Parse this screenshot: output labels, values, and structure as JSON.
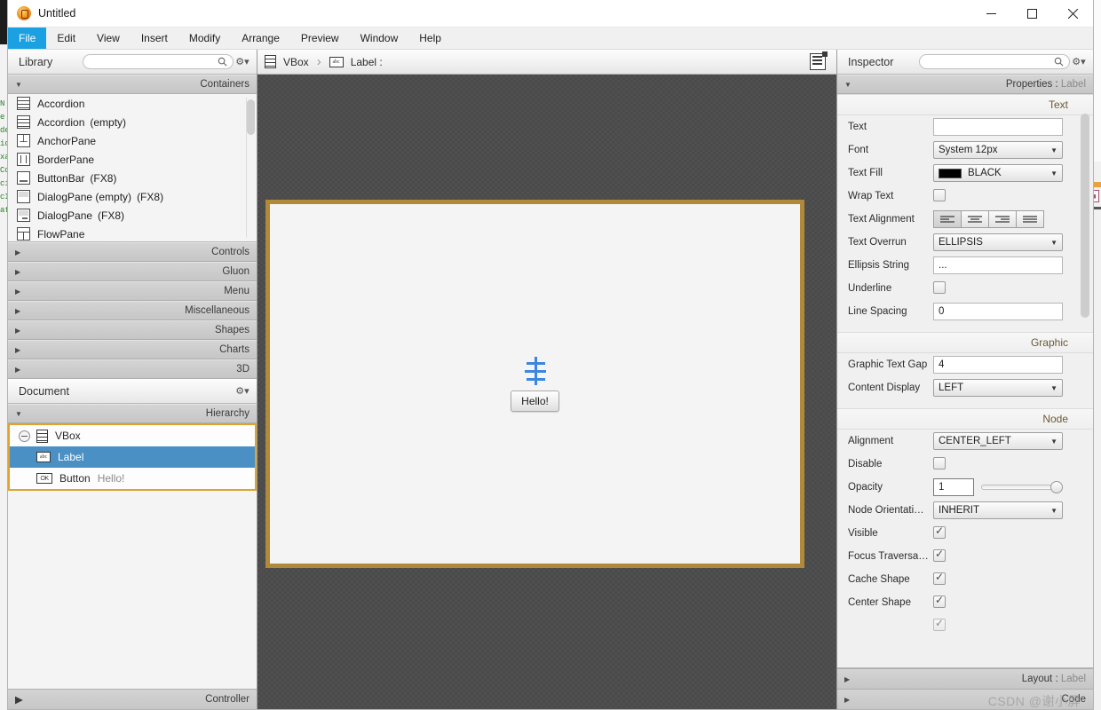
{
  "window": {
    "title": "Untitled",
    "app_icon": "scenebuilder-icon",
    "controls": {
      "minimize": "minimize-icon",
      "maximize": "maximize-icon",
      "close": "close-icon"
    }
  },
  "menubar": {
    "items": [
      {
        "label": "File",
        "mnemonic": "F",
        "active": true
      },
      {
        "label": "Edit",
        "mnemonic": "E",
        "active": false
      },
      {
        "label": "View",
        "mnemonic": "V",
        "active": false
      },
      {
        "label": "Insert",
        "mnemonic": "I",
        "active": false
      },
      {
        "label": "Modify",
        "mnemonic": "o",
        "active": false
      },
      {
        "label": "Arrange",
        "mnemonic": "A",
        "active": false
      },
      {
        "label": "Preview",
        "mnemonic": "P",
        "active": false
      },
      {
        "label": "Window",
        "mnemonic": "W",
        "active": false
      },
      {
        "label": "Help",
        "mnemonic": "",
        "active": false
      }
    ]
  },
  "library": {
    "title": "Library",
    "search_placeholder": "",
    "search_value": "",
    "search_icon": "search-icon",
    "gear_icon": "gear-icon",
    "section": {
      "label": "Containers",
      "expanded": true
    },
    "items": [
      {
        "name": "Accordion",
        "suffix": "",
        "icon": "accordion-icon"
      },
      {
        "name": "Accordion",
        "suffix": "(empty)",
        "icon": "accordion-empty-icon"
      },
      {
        "name": "AnchorPane",
        "suffix": "",
        "icon": "anchorpane-icon"
      },
      {
        "name": "BorderPane",
        "suffix": "",
        "icon": "borderpane-icon"
      },
      {
        "name": "ButtonBar",
        "suffix": "(FX8)",
        "icon": "buttonbar-icon"
      },
      {
        "name": "DialogPane (empty)",
        "suffix": "(FX8)",
        "icon": "dialogpane-empty-icon"
      },
      {
        "name": "DialogPane",
        "suffix": "(FX8)",
        "icon": "dialogpane-icon"
      },
      {
        "name": "FlowPane",
        "suffix": "",
        "icon": "flowpane-icon"
      }
    ],
    "collapsed_sections": [
      "Controls",
      "Gluon",
      "Menu",
      "Miscellaneous",
      "Shapes",
      "Charts",
      "3D"
    ]
  },
  "document": {
    "title": "Document",
    "gear_icon": "gear-icon",
    "hierarchy_label": "Hierarchy",
    "controller_label": "Controller",
    "tree": [
      {
        "label": "VBox",
        "value": "",
        "icon": "vbox-icon",
        "selected": false,
        "indent": 0,
        "expander": "collapse-icon"
      },
      {
        "label": "Label",
        "value": "",
        "icon": "label-icon",
        "selected": true,
        "indent": 1,
        "expander": ""
      },
      {
        "label": "Button",
        "value": "Hello!",
        "icon": "button-icon",
        "selected": false,
        "indent": 1,
        "expander": ""
      }
    ]
  },
  "breadcrumb": {
    "items": [
      {
        "label": "VBox",
        "icon": "vbox-icon"
      },
      {
        "label": "Label :",
        "icon": "label-icon"
      }
    ],
    "separator": "›",
    "doc_icon": "document-icon"
  },
  "canvas": {
    "selected_node": "VBox",
    "label_placeholder_icon": "empty-label-placeholder",
    "button_text": "Hello!",
    "selection_color": "#b08a39",
    "content_background": "#f4f4f4"
  },
  "inspector": {
    "title": "Inspector",
    "search_placeholder": "",
    "search_value": "",
    "search_icon": "search-icon",
    "gear_icon": "gear-icon",
    "header": {
      "prefix": "Properties",
      "separator": ":",
      "target": "Label"
    },
    "groups": [
      {
        "name": "Text",
        "rows": [
          {
            "label": "Text",
            "type": "text",
            "value": ""
          },
          {
            "label": "Font",
            "type": "combo",
            "value": "System 12px"
          },
          {
            "label": "Text Fill",
            "type": "color",
            "value": "BLACK",
            "swatch": "#000000"
          },
          {
            "label": "Wrap Text",
            "type": "checkbox",
            "value": false
          },
          {
            "label": "Text Alignment",
            "type": "align",
            "value": "LEFT",
            "options": [
              "left-align-icon",
              "center-align-icon",
              "right-align-icon",
              "justify-align-icon"
            ]
          },
          {
            "label": "Text Overrun",
            "type": "combo",
            "value": "ELLIPSIS"
          },
          {
            "label": "Ellipsis String",
            "type": "text",
            "value": "..."
          },
          {
            "label": "Underline",
            "type": "checkbox",
            "value": false
          },
          {
            "label": "Line Spacing",
            "type": "text",
            "value": "0"
          }
        ]
      },
      {
        "name": "Graphic",
        "rows": [
          {
            "label": "Graphic Text Gap",
            "type": "text",
            "value": "4"
          },
          {
            "label": "Content Display",
            "type": "combo",
            "value": "LEFT"
          }
        ]
      },
      {
        "name": "Node",
        "rows": [
          {
            "label": "Alignment",
            "type": "combo",
            "value": "CENTER_LEFT"
          },
          {
            "label": "Disable",
            "type": "checkbox",
            "value": false
          },
          {
            "label": "Opacity",
            "type": "slider",
            "value": "1"
          },
          {
            "label": "Node Orientati…",
            "type": "combo",
            "value": "INHERIT"
          },
          {
            "label": "Visible",
            "type": "checkbox",
            "value": true
          },
          {
            "label": "Focus Traversa…",
            "type": "checkbox",
            "value": true
          },
          {
            "label": "Cache Shape",
            "type": "checkbox",
            "value": true
          },
          {
            "label": "Center Shape",
            "type": "checkbox",
            "value": true
          }
        ]
      }
    ],
    "footer_sections": [
      {
        "prefix": "Layout",
        "separator": ":",
        "target": "Label"
      },
      {
        "prefix": "Code",
        "separator": "",
        "target": ""
      }
    ]
  },
  "watermark": {
    "text": "CSDN @谢小屏"
  }
}
